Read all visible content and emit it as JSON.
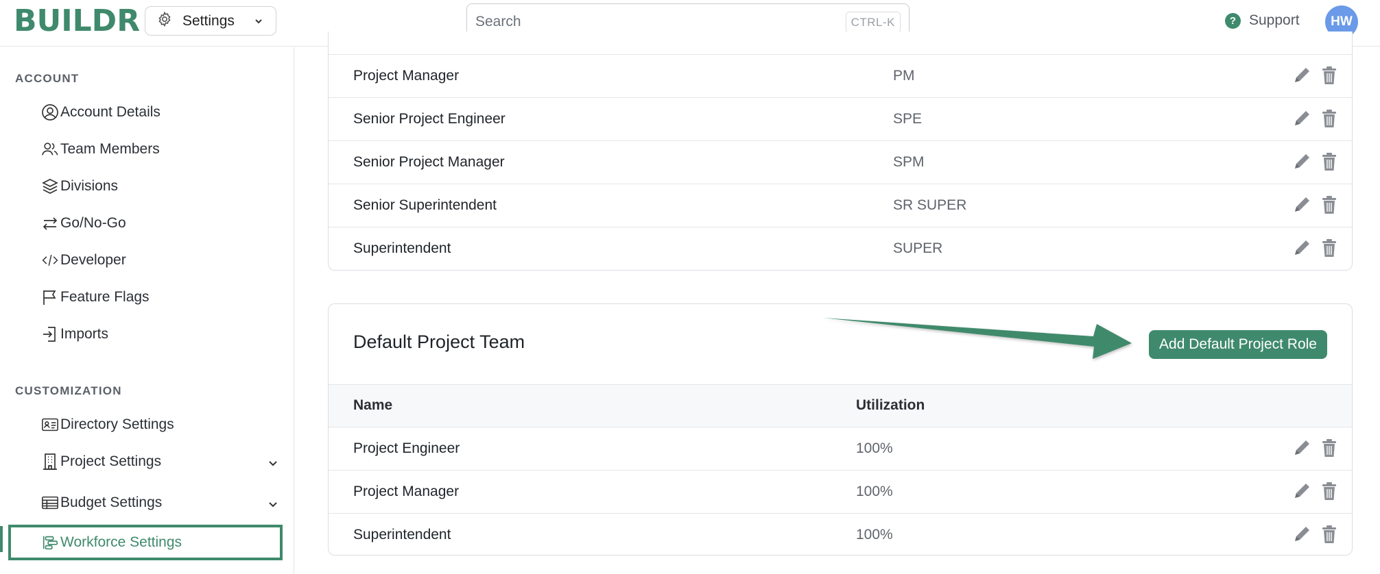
{
  "topbar": {
    "logo": "BUILDR",
    "settings_label": "Settings",
    "search_placeholder": "Search",
    "search_shortcut": "CTRL-K",
    "support_label": "Support",
    "avatar_initials": "HW"
  },
  "sidebar": {
    "account_title": "ACCOUNT",
    "account_items": [
      {
        "label": "Account Details",
        "icon": "user-circle-icon"
      },
      {
        "label": "Team Members",
        "icon": "users-icon"
      },
      {
        "label": "Divisions",
        "icon": "layers-icon"
      },
      {
        "label": "Go/No-Go",
        "icon": "arrows-swap-icon"
      },
      {
        "label": "Developer",
        "icon": "code-icon"
      },
      {
        "label": "Feature Flags",
        "icon": "flag-icon"
      },
      {
        "label": "Imports",
        "icon": "import-icon"
      }
    ],
    "customization_title": "CUSTOMIZATION",
    "customization_items": [
      {
        "label": "Directory Settings",
        "icon": "id-card-icon"
      },
      {
        "label": "Project Settings",
        "icon": "building-icon"
      },
      {
        "label": "Budget Settings",
        "icon": "table-icon"
      },
      {
        "label": "Workforce Settings",
        "icon": "workforce-icon"
      }
    ]
  },
  "roles_table": {
    "rows": [
      {
        "name": "Project Manager",
        "abbr": "PM"
      },
      {
        "name": "Senior Project Engineer",
        "abbr": "SPE"
      },
      {
        "name": "Senior Project Manager",
        "abbr": "SPM"
      },
      {
        "name": "Senior Superintendent",
        "abbr": "SR SUPER"
      },
      {
        "name": "Superintendent",
        "abbr": "SUPER"
      }
    ]
  },
  "default_team": {
    "title": "Default Project Team",
    "add_button": "Add Default Project Role",
    "columns": [
      "Name",
      "Utilization"
    ],
    "rows": [
      {
        "name": "Project Engineer",
        "utilization": "100%"
      },
      {
        "name": "Project Manager",
        "utilization": "100%"
      },
      {
        "name": "Superintendent",
        "utilization": "100%"
      }
    ]
  },
  "colors": {
    "brand": "#3f8a6c",
    "avatar": "#6a9ae8"
  }
}
